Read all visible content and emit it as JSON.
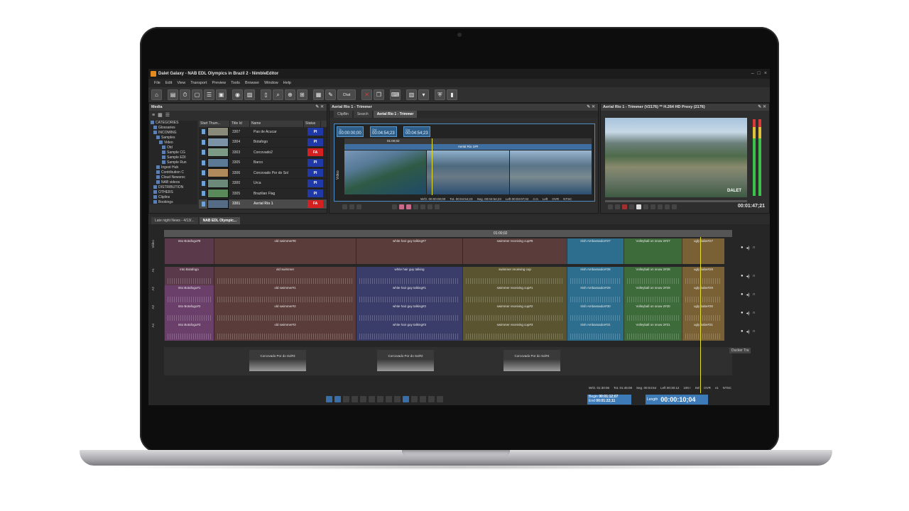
{
  "window": {
    "title": "Dalet Galaxy - NAB EDL Olympics in Brazil 2 - NimbleEditor"
  },
  "menu": [
    "File",
    "Edit",
    "View",
    "Transport",
    "Preview",
    "Tools",
    "Browser",
    "Window",
    "Help"
  ],
  "toolbar": {
    "chat_label": "Chat"
  },
  "media_panel": {
    "title": "Media",
    "tree": [
      {
        "label": "CATEGORIES",
        "indent": 0
      },
      {
        "label": "Glossaries",
        "indent": 1
      },
      {
        "label": "INCOMING",
        "indent": 1
      },
      {
        "label": "Samples",
        "indent": 2
      },
      {
        "label": "Video",
        "indent": 3
      },
      {
        "label": "Old",
        "indent": 4
      },
      {
        "label": "Sample CG",
        "indent": 4
      },
      {
        "label": "Sample EDI",
        "indent": 4
      },
      {
        "label": "Sample Run",
        "indent": 4
      },
      {
        "label": "Ingest Hub",
        "indent": 2
      },
      {
        "label": "Contribution C",
        "indent": 2
      },
      {
        "label": "Cloud Newsroc",
        "indent": 2
      },
      {
        "label": "NAB videos",
        "indent": 2
      },
      {
        "label": "DISTRIBUTION",
        "indent": 1
      },
      {
        "label": "OTHERS",
        "indent": 1
      },
      {
        "label": "Cliplins",
        "indent": 1
      },
      {
        "label": "Bookings",
        "indent": 1
      }
    ],
    "columns": [
      "Start Thum...",
      "Title Id",
      "Name",
      "Status"
    ],
    "rows": [
      {
        "id": "3307",
        "name": "Pao de Acucar",
        "status": "PI",
        "status_color": "#1f3aa8",
        "thumb": "#8a8a7a",
        "selected": false
      },
      {
        "id": "3304",
        "name": "Botafogo",
        "status": "PI",
        "status_color": "#1f3aa8",
        "thumb": "#7c92a6",
        "selected": false
      },
      {
        "id": "3303",
        "name": "Corcovado2",
        "status": "FA",
        "status_color": "#d42020",
        "thumb": "#7c9a86",
        "selected": false
      },
      {
        "id": "3305",
        "name": "Barco",
        "status": "PI",
        "status_color": "#1f3aa8",
        "thumb": "#5c7a96",
        "selected": false
      },
      {
        "id": "3306",
        "name": "Corcovado Por do Sol",
        "status": "PI",
        "status_color": "#1f3aa8",
        "thumb": "#b08a5a",
        "selected": false
      },
      {
        "id": "3300",
        "name": "Urca",
        "status": "PI",
        "status_color": "#1f3aa8",
        "thumb": "#6b8a7a",
        "selected": false
      },
      {
        "id": "3305",
        "name": "Brazilian Flag",
        "status": "PI",
        "status_color": "#1f3aa8",
        "thumb": "#5a8a5a",
        "selected": false
      },
      {
        "id": "3301",
        "name": "Aerial Rio 1",
        "status": "FA",
        "status_color": "#d42020",
        "thumb": "#556b86",
        "selected": true
      }
    ]
  },
  "trimmer": {
    "title": "Aerial Rio 1 - Trimmer",
    "tabs": [
      "ClipBin",
      "Search",
      "Aerial Rio 1 - Trimmer"
    ],
    "tc_in": {
      "label": "Tc",
      "value": "00:00:00;00"
    },
    "tc_out": {
      "label": "Out",
      "value": "00:04:54;23"
    },
    "tc_dur": {
      "label": "Dur",
      "value": "00:04:54;23"
    },
    "ruler_mark": "01:00;02",
    "clip_label": "Aerial Rio 1##",
    "track_label": "Video",
    "status": [
      "W/O. 00:00:00;00",
      "Tot. 00:04:54;23",
      "Seg. 00:04:54;23",
      "Left 00:03:07;02",
      "4 m",
      "Left",
      "OVR",
      "NTSC"
    ]
  },
  "preview": {
    "title": "Aerial Rio 1 - Trimmer (V2176) ** H.264 HD Proxy (2176)",
    "watermark": "DALET",
    "timecode": "00:01:47;21"
  },
  "timeline": {
    "tabs": [
      "Late night News - 4/13/...",
      "NAB EDL Olympic..."
    ],
    "ruler_mark": "01:00;02",
    "tracks": [
      {
        "label": "Video",
        "clips": [
          {
            "name": "Into Botafogo#8",
            "color": "#5a3a4a"
          },
          {
            "name": "old swimmer#8",
            "color": "#5a3d3a"
          },
          {
            "name": "white hair guy talking#7",
            "color": "#5a3d3a"
          },
          {
            "name": "swimmer receiving cup#8",
            "color": "#5a3d3a"
          },
          {
            "name": "Irish Ambassador#27",
            "color": "#2d6e8e"
          },
          {
            "name": "Volleyball on snow 2#27",
            "color": "#3e6b3a"
          },
          {
            "name": "ugly babe#27",
            "color": "#7a6035"
          }
        ]
      },
      {
        "label": "A1",
        "clips": [
          {
            "name": "Into Botafogo",
            "color": "#5a3a4a"
          },
          {
            "name": "old swimmer",
            "color": "#5a3d3a"
          },
          {
            "name": "white hair guy talking",
            "color": "#3a3d6a"
          },
          {
            "name": "swimmer receiving cup",
            "color": "#5a5530"
          },
          {
            "name": "Irish Ambassador#28",
            "color": "#2d6e8e"
          },
          {
            "name": "Volleyball on snow 2#28",
            "color": "#3e6b3a"
          },
          {
            "name": "ugly babe#28",
            "color": "#7a6035"
          }
        ]
      },
      {
        "label": "A2",
        "clips": [
          {
            "name": "Into Botafogo#1",
            "color": "#6a3f6a"
          },
          {
            "name": "old swimmer#1",
            "color": "#5a3d3a"
          },
          {
            "name": "white hair guy talking#1",
            "color": "#3a3d6a"
          },
          {
            "name": "swimmer receiving cup#1",
            "color": "#5a5530"
          },
          {
            "name": "Irish Ambassador#29",
            "color": "#2d6e8e"
          },
          {
            "name": "Volleyball on snow 2#29",
            "color": "#3e6b3a"
          },
          {
            "name": "ugly babe#29",
            "color": "#7a6035"
          }
        ]
      },
      {
        "label": "A3",
        "clips": [
          {
            "name": "Into Botafogo#2",
            "color": "#6a3f6a"
          },
          {
            "name": "old swimmer#2",
            "color": "#5a3d3a"
          },
          {
            "name": "white hair guy talking#2",
            "color": "#3a3d6a"
          },
          {
            "name": "swimmer receiving cup#2",
            "color": "#5a5530"
          },
          {
            "name": "Irish Ambassador#30",
            "color": "#2d6e8e"
          },
          {
            "name": "Volleyball on snow 2#30",
            "color": "#3e6b3a"
          },
          {
            "name": "ugly babe#30",
            "color": "#7a6035"
          }
        ]
      },
      {
        "label": "A4",
        "clips": [
          {
            "name": "Into Botafogo#3",
            "color": "#6a3f6a"
          },
          {
            "name": "old swimmer#3",
            "color": "#5a3d3a"
          },
          {
            "name": "white hair guy talking#3",
            "color": "#3a3d6a"
          },
          {
            "name": "swimmer receiving cup#3",
            "color": "#5a5530"
          },
          {
            "name": "Irish Ambassador#31",
            "color": "#2d6e8e"
          },
          {
            "name": "Volleyball on snow 2#31",
            "color": "#3e6b3a"
          },
          {
            "name": "ugly babe#31",
            "color": "#7a6035"
          }
        ]
      }
    ],
    "music_clips": [
      "Corcovado Por do Sol#3",
      "Corcovado Por do Sol#2",
      "Corcovado Por do Sol#4"
    ],
    "ducker_label": "Ducker Tra",
    "status": [
      "W/O. 01:30:06",
      "Tot. 01:45:08",
      "Seg. 00:04:54",
      "Left 00:30:12",
      "100 r",
      "Sel",
      "OVR",
      "v1",
      "NTSC"
    ],
    "begin": {
      "label": "Begin",
      "value": "00:01:12;07"
    },
    "end": {
      "label": "End",
      "value": "00:01:22;11"
    },
    "length": {
      "label": "Length",
      "value": "00:00:10;04"
    }
  },
  "colors": {
    "accent_blue": "#3c7ab8",
    "status_red": "#d42020",
    "status_blue": "#1f3aa8",
    "playhead": "#e8e030"
  }
}
